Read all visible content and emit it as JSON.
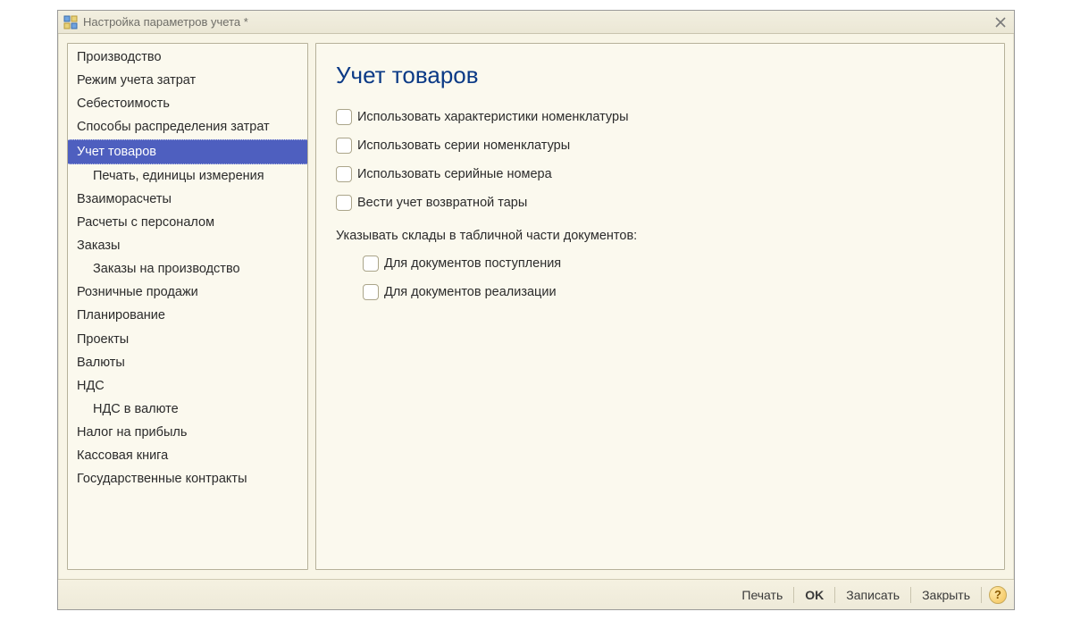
{
  "window": {
    "title": "Настройка параметров учета *"
  },
  "sidebar": {
    "items": [
      {
        "label": "Производство",
        "sub": false,
        "selected": false
      },
      {
        "label": "Режим учета затрат",
        "sub": false,
        "selected": false
      },
      {
        "label": "Себестоимость",
        "sub": false,
        "selected": false
      },
      {
        "label": "Способы распределения затрат",
        "sub": false,
        "selected": false
      },
      {
        "label": "Учет товаров",
        "sub": false,
        "selected": true
      },
      {
        "label": "Печать, единицы измерения",
        "sub": true,
        "selected": false
      },
      {
        "label": "Взаиморасчеты",
        "sub": false,
        "selected": false
      },
      {
        "label": "Расчеты с персоналом",
        "sub": false,
        "selected": false
      },
      {
        "label": "Заказы",
        "sub": false,
        "selected": false
      },
      {
        "label": "Заказы на производство",
        "sub": true,
        "selected": false
      },
      {
        "label": "Розничные продажи",
        "sub": false,
        "selected": false
      },
      {
        "label": "Планирование",
        "sub": false,
        "selected": false
      },
      {
        "label": "Проекты",
        "sub": false,
        "selected": false
      },
      {
        "label": "Валюты",
        "sub": false,
        "selected": false
      },
      {
        "label": "НДС",
        "sub": false,
        "selected": false
      },
      {
        "label": "НДС в валюте",
        "sub": true,
        "selected": false
      },
      {
        "label": "Налог на прибыль",
        "sub": false,
        "selected": false
      },
      {
        "label": "Кассовая книга",
        "sub": false,
        "selected": false
      },
      {
        "label": "Государственные контракты",
        "sub": false,
        "selected": false
      }
    ]
  },
  "main": {
    "heading": "Учет товаров",
    "checkboxes": [
      {
        "label": "Использовать характеристики номенклатуры",
        "checked": false
      },
      {
        "label": "Использовать серии номенклатуры",
        "checked": false
      },
      {
        "label": "Использовать серийные номера",
        "checked": false
      },
      {
        "label": "Вести учет возвратной тары",
        "checked": false
      }
    ],
    "section_label": "Указывать склады в табличной части документов:",
    "sub_checkboxes": [
      {
        "label": "Для документов поступления",
        "checked": false
      },
      {
        "label": "Для документов реализации",
        "checked": false
      }
    ]
  },
  "footer": {
    "print": "Печать",
    "ok": "OK",
    "save": "Записать",
    "close": "Закрыть",
    "help": "?"
  }
}
